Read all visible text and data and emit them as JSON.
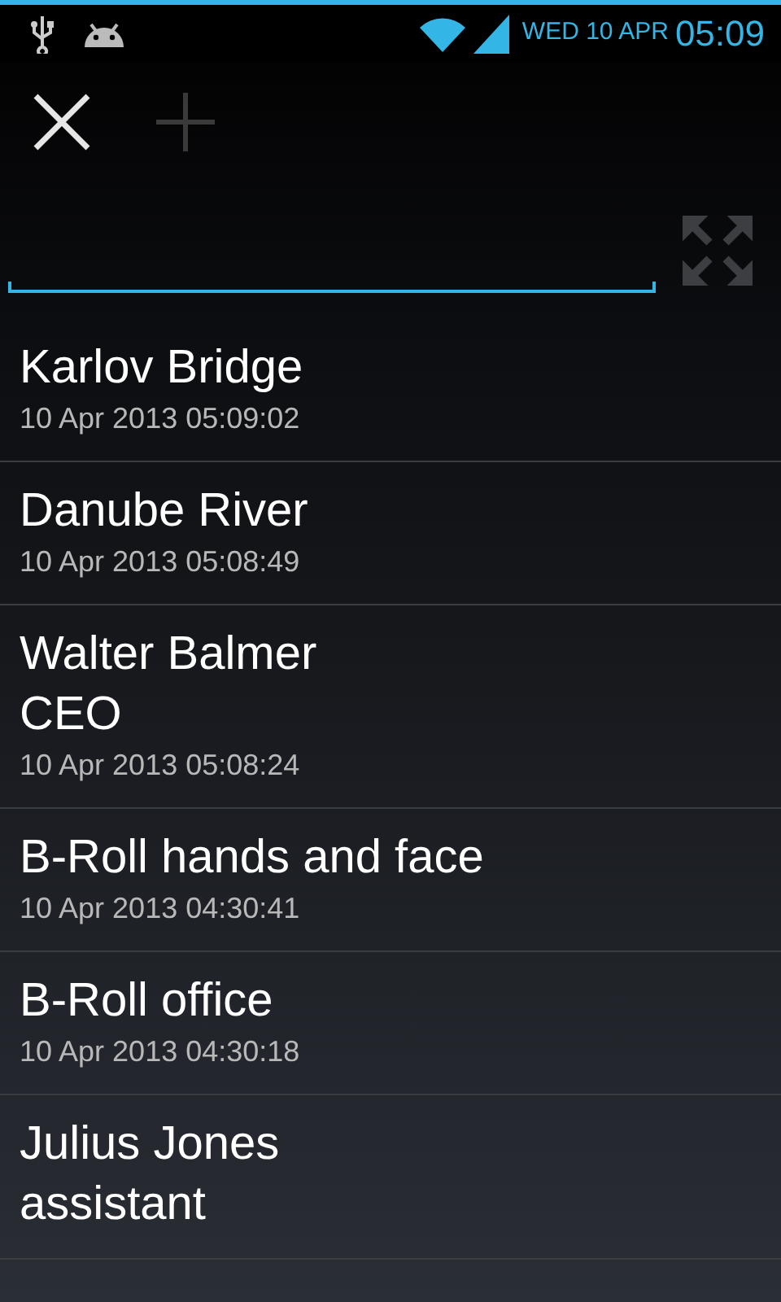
{
  "status_bar": {
    "date": "WED 10 APR",
    "time": "05:09"
  },
  "toolbar": {
    "close_enabled": true,
    "add_enabled": false,
    "expand_enabled": false
  },
  "items": [
    {
      "title_lines": [
        "Karlov Bridge"
      ],
      "timestamp": "10 Apr 2013 05:09:02"
    },
    {
      "title_lines": [
        "Danube River"
      ],
      "timestamp": "10 Apr 2013 05:08:49"
    },
    {
      "title_lines": [
        "Walter Balmer",
        "CEO"
      ],
      "timestamp": "10 Apr 2013 05:08:24"
    },
    {
      "title_lines": [
        "B-Roll hands and face"
      ],
      "timestamp": "10 Apr 2013 04:30:41"
    },
    {
      "title_lines": [
        "B-Roll office"
      ],
      "timestamp": "10 Apr 2013 04:30:18"
    },
    {
      "title_lines": [
        "Julius Jones",
        "assistant"
      ]
    }
  ]
}
